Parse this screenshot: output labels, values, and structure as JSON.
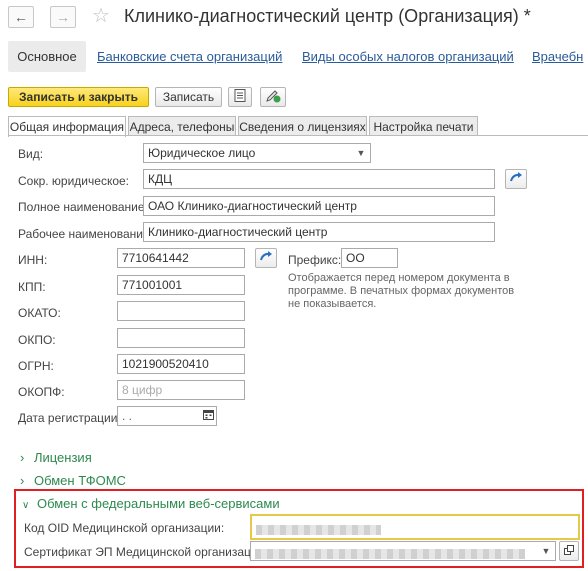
{
  "window": {
    "title": "Клинико-диагностический центр (Организация) *"
  },
  "nav": {
    "back_icon": "arrow-left-icon",
    "forward_icon": "arrow-right-icon",
    "active": "Основное",
    "links": [
      "Банковские счета организаций",
      "Виды особых налогов организаций",
      "Врачебн"
    ]
  },
  "toolbar": {
    "save_close": "Записать и закрыть",
    "save": "Записать"
  },
  "tabs": [
    "Общая информация",
    "Адреса, телефоны",
    "Сведения о лицензиях",
    "Настройка печати"
  ],
  "form": {
    "vid": {
      "label": "Вид:",
      "value": "Юридическое лицо"
    },
    "short_name": {
      "label": "Сокр. юридическое:",
      "value": "КДЦ"
    },
    "full_name": {
      "label": "Полное наименование:",
      "value": "ОАО Клинико-диагностический центр"
    },
    "work_name": {
      "label": "Рабочее наименование:",
      "value": "Клинико-диагностический центр"
    },
    "inn": {
      "label": "ИНН:",
      "value": "7710641442"
    },
    "kpp": {
      "label": "КПП:",
      "value": "771001001"
    },
    "okato": {
      "label": "ОКАТО:",
      "value": ""
    },
    "okpo": {
      "label": "ОКПО:",
      "value": ""
    },
    "ogrn": {
      "label": "ОГРН:",
      "value": "1021900520410"
    },
    "okopf": {
      "label": "ОКОПФ:",
      "placeholder": "8 цифр"
    },
    "reg_date": {
      "label": "Дата регистрации:",
      "value": " .  ."
    },
    "prefix": {
      "label": "Префикс:",
      "value": "ОО"
    },
    "prefix_hint": "Отображается перед номером документа в программе. В печатных формах документов не показывается."
  },
  "groups": {
    "license": "Лицензия",
    "tfoms": "Обмен ТФОМС",
    "federal": "Обмен с федеральными веб-сервисами"
  },
  "federal": {
    "oid_label": "Код OID Медицинской организации:",
    "cert_label": "Сертификат ЭП Медицинской организации:"
  }
}
